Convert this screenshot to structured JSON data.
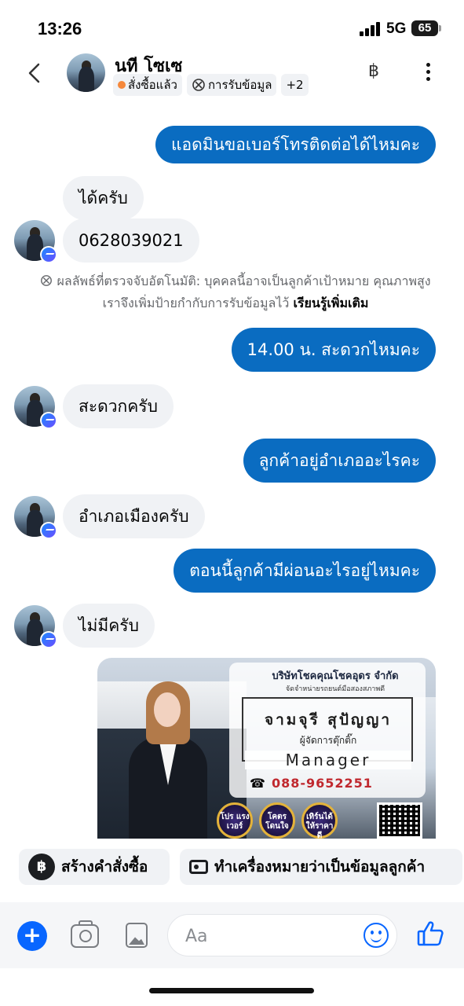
{
  "status": {
    "time": "13:26",
    "network": "5G",
    "battery": "65"
  },
  "header": {
    "name": "นที โซเซ",
    "tags": [
      {
        "label": "สั่งซื้อแล้ว"
      },
      {
        "label": "การรับข้อมูล"
      },
      {
        "label": "+2"
      }
    ],
    "currency_icon": "฿"
  },
  "messages": [
    {
      "dir": "out",
      "text": "แอดมินขอเบอร์โทรติดต่อได้ไหมคะ"
    },
    {
      "dir": "in",
      "text": "ได้ครับ"
    },
    {
      "dir": "in",
      "text": "0628039021"
    },
    {
      "dir": "out",
      "text": "14.00 น.  สะดวกไหมคะ"
    },
    {
      "dir": "in",
      "text": "สะดวกครับ"
    },
    {
      "dir": "out",
      "text": "ลูกค้าอยู่อำเภออะไรคะ"
    },
    {
      "dir": "in",
      "text": "อำเภอเมืองครับ"
    },
    {
      "dir": "out",
      "text": "ตอนนี้ลูกค้ามีผ่อนอะไรอยู่ไหมคะ"
    },
    {
      "dir": "in",
      "text": "ไม่มีครับ"
    }
  ],
  "notice": {
    "text": "ผลลัพธ์ที่ตรวจจับอัตโนมัติ: บุคคลนี้อาจเป็นลูกค้าเป้าหมาย คุณภาพสูง เราจึงเพิ่มป้ายกำกับการรับข้อมูลไว้ ",
    "link": "เรียนรู้เพิ่มเติม"
  },
  "card": {
    "company": "บริษัทโชคคุณโชคอุดร จำกัด",
    "company_sub": "จัดจำหน่ายรถยนต์มือสองสภาพดี",
    "person_name": "จามจุรี สุปัญญา",
    "person_title": "ผู้จัดการตุ๊กติ๊ก",
    "role": "Manager",
    "phone": "088-9652251",
    "badges": [
      "โปร แรง เวอร์",
      "โคตร โดนใจ",
      "เทิร์นได้ ให้ราคาดี"
    ]
  },
  "quick_actions": {
    "create_order": "สร้างคำสั่งซื้อ",
    "mark_lead": "ทำเครื่องหมายว่าเป็นข้อมูลลูกค้า"
  },
  "composer": {
    "placeholder": "Aa"
  },
  "colors": {
    "outgoing": "#0a6cc1",
    "incoming": "#f0f2f5",
    "accent": "#0866ff"
  },
  "icons": [
    "back-chevron-icon",
    "baht-icon",
    "more-icon",
    "messenger-badge-icon",
    "plus-icon",
    "camera-icon",
    "gallery-icon",
    "emoji-icon",
    "thumbs-up-icon"
  ]
}
